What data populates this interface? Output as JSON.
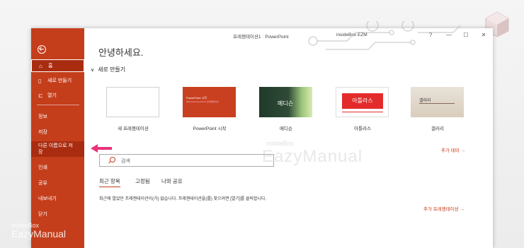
{
  "window": {
    "title": "프레젠테이션1 · PowerPoint",
    "user": "insideBox EZM",
    "buttons": [
      "?",
      "—",
      "☐",
      "✕"
    ]
  },
  "sidebar": {
    "items": [
      {
        "label": "홈",
        "icon": "home-icon"
      },
      {
        "label": "새로 만들기",
        "icon": "new-file-icon"
      },
      {
        "label": "열기",
        "icon": "folder-open-icon"
      },
      {
        "label": "정보"
      },
      {
        "label": "저장"
      },
      {
        "label": "다른 이름으로 저장"
      },
      {
        "label": "인쇄"
      },
      {
        "label": "공유"
      },
      {
        "label": "내보내기"
      },
      {
        "label": "닫기"
      }
    ]
  },
  "main": {
    "greeting": "안녕하세요.",
    "new_section": "새로 만들기",
    "templates": [
      {
        "label": "새 프레젠테이션"
      },
      {
        "label": "PowerPoint 시작",
        "thumb_text": "PowerPoint 시작",
        "thumb_sub": "Microsoft PowerPoint 프레젠테이션"
      },
      {
        "label": "메디슨",
        "thumb_text": "메디슨"
      },
      {
        "label": "아틀라스",
        "thumb_text": "아틀라스"
      },
      {
        "label": "갤러리",
        "thumb_text": "갤러리"
      }
    ],
    "more_themes": "추가 테마 →",
    "search_placeholder": "검색",
    "tabs": [
      "최근 항목",
      "고정됨",
      "나와 공유"
    ],
    "empty_message": "최근에 열었던 프레젠테이션이(가) 없습니다. 프레젠테이션을(를) 찾으려면 [열기]를 클릭합니다.",
    "more_presentations": "추가 프레젠테이션 →"
  },
  "watermark": {
    "left_small": "insideBox",
    "left_big": "EazyManual",
    "center_small": "insideBox",
    "center_big": "EazyManual"
  },
  "colors": {
    "accent": "#c43e1c",
    "selected": "#a92c10",
    "arrow": "#e8357a"
  }
}
